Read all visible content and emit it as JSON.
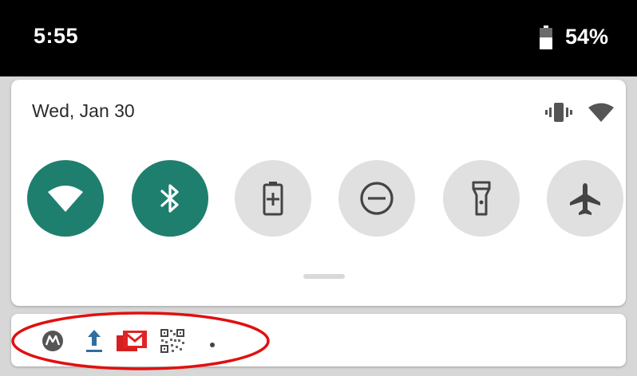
{
  "status_bar": {
    "time": "5:55",
    "battery_percent": "54%",
    "battery_icon": "battery-icon"
  },
  "quick_settings": {
    "date": "Wed, Jan 30",
    "header_icons": [
      "vibrate-icon",
      "wifi-signal-icon"
    ],
    "accent_color": "#1f7f6e",
    "tiles": [
      {
        "name": "wifi",
        "icon": "wifi-icon",
        "state": "on"
      },
      {
        "name": "bluetooth",
        "icon": "bluetooth-icon",
        "state": "on"
      },
      {
        "name": "battery-saver",
        "icon": "battery-saver-icon",
        "state": "off"
      },
      {
        "name": "do-not-disturb",
        "icon": "do-not-disturb-icon",
        "state": "off"
      },
      {
        "name": "flashlight",
        "icon": "flashlight-icon",
        "state": "off"
      },
      {
        "name": "airplane-mode",
        "icon": "airplane-icon",
        "state": "off"
      }
    ]
  },
  "notification_row": {
    "icons": [
      "motorola-icon",
      "upload-icon",
      "gmail-icon",
      "qr-code-icon",
      "more-dot-icon"
    ],
    "highlight_color": "#e01010"
  }
}
